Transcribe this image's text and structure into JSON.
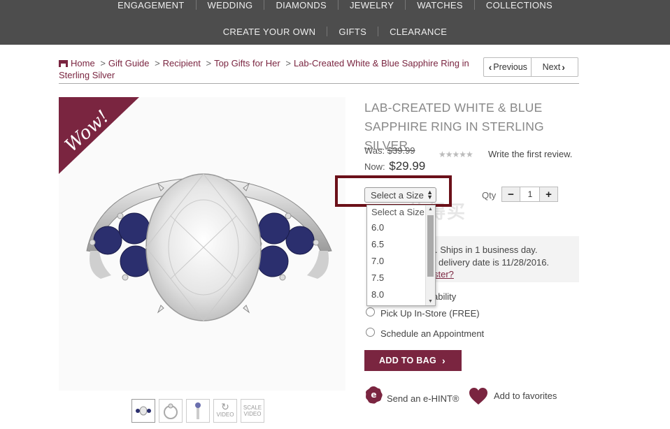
{
  "nav": {
    "row1": [
      "ENGAGEMENT",
      "WEDDING",
      "DIAMONDS",
      "JEWELRY",
      "WATCHES",
      "COLLECTIONS"
    ],
    "row2": [
      "CREATE YOUR OWN",
      "GIFTS",
      "CLEARANCE"
    ]
  },
  "breadcrumb": {
    "home": "Home",
    "items": [
      "Gift Guide",
      "Recipient",
      "Top Gifts for Her"
    ],
    "current": "Lab-Created White & Blue Sapphire Ring in Sterling Silver",
    "separator": ">"
  },
  "pager": {
    "previous": "Previous",
    "next": "Next"
  },
  "badge": {
    "text": "Wow!"
  },
  "product": {
    "title": "LAB-CREATED WHITE & BLUE SAPPHIRE RING IN STERLING SILVER",
    "was_label": "Was:",
    "was_price": "$39.99",
    "now_label": "Now:",
    "now_price": "$29.99",
    "rating_stars": "★★★★★",
    "review_link": "Write the first review."
  },
  "size_select": {
    "value": "Select a Size",
    "options": [
      "Select a Size",
      "6.0",
      "6.5",
      "7.0",
      "7.5",
      "8.0"
    ]
  },
  "qty": {
    "label": "Qty",
    "minus": "−",
    "value": "1",
    "plus": "+"
  },
  "shipping": {
    "line1": ". Ships in 1 business day.",
    "line2": "delivery date is 11/28/2016.",
    "link": "ster?",
    "availability_fragment": "ability"
  },
  "fulfillment": {
    "pickup": "Pick Up In-Store (FREE)",
    "appointment": "Schedule an Appointment"
  },
  "add_to_bag": "ADD TO BAG",
  "ehint": {
    "icon_letter": "e",
    "label": "Send an e-HINT®"
  },
  "favorites": {
    "label": "Add to favorites"
  },
  "thumbnails": [
    "",
    "",
    "",
    "VIDEO",
    "SCALE VIDEO"
  ],
  "watermark": "值得买",
  "colors": {
    "brand": "#7a2540",
    "nav_bg": "#4d4d4d",
    "highlight": "#6b1019",
    "sapphire": "#2b2f6e"
  }
}
